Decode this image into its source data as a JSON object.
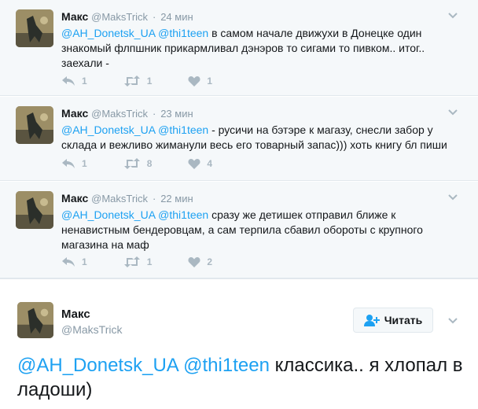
{
  "colors": {
    "mention": "#1da1f2",
    "muted": "#8899a6",
    "icon": "#aab8c2",
    "background": "#f5f8fa"
  },
  "tweets": [
    {
      "name": "Макс",
      "handle": "@MaksTrick",
      "dot": "·",
      "time": "24 мин",
      "mention1": "@AH_Donetsk_UA",
      "mention2": "@thi1teen",
      "text": " в самом начале движухи в Донецке один знакомый флпшник прикармливал дэнэров то сигами то пивком.. итог.. заехали -",
      "replies": "1",
      "retweets": "1",
      "likes": "1"
    },
    {
      "name": "Макс",
      "handle": "@MaksTrick",
      "dot": "·",
      "time": "23 мин",
      "mention1": "@AH_Donetsk_UA",
      "mention2": "@thi1teen",
      "text": " - русичи на бэтэре к магазу, снесли забор у склада и вежливо жиманули весь его товарный запас))) хоть книгу бл пиши",
      "replies": "1",
      "retweets": "8",
      "likes": "4"
    },
    {
      "name": "Макс",
      "handle": "@MaksTrick",
      "dot": "·",
      "time": "22 мин",
      "mention1": "@AH_Donetsk_UA",
      "mention2": "@thi1teen",
      "text": " сразу же детишек отправил ближе к ненавистным бендеровцам, а сам терпила сбавил обороты с крупного магазина на маф",
      "replies": "1",
      "retweets": "1",
      "likes": "2"
    }
  ],
  "main": {
    "name": "Макс",
    "handle": "@MaksTrick",
    "follow_label": "Читать",
    "mention1": "@AH_Donetsk_UA",
    "mention2": "@thi1teen",
    "text": " классика.. я хлопал в ладоши)"
  }
}
